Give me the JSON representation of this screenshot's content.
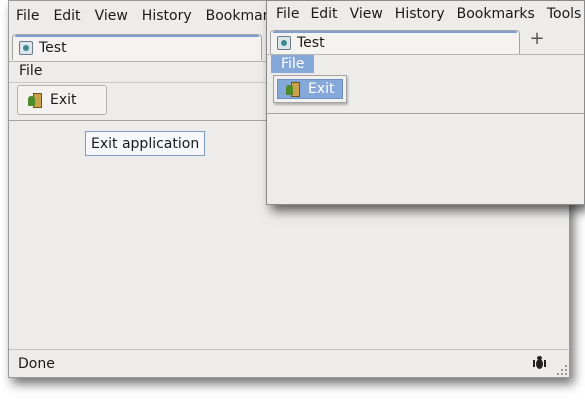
{
  "browser_menu": [
    "File",
    "Edit",
    "View",
    "History",
    "Bookmarks",
    "Tools"
  ],
  "tab_title": "Test",
  "new_tab_symbol": "+",
  "page_menu": {
    "file_label": "File"
  },
  "toolbar": {
    "exit_label": "Exit",
    "exit_icon": "exit-door-icon"
  },
  "tooltip": "Exit application",
  "status": {
    "text": "Done",
    "icon": "bug-icon"
  },
  "dropdown": {
    "exit_label": "Exit"
  },
  "colors": {
    "window_bg": "#edeceb",
    "tab_accent": "#7b9fce",
    "menu_highlight": "#86a8d8",
    "tooltip_border": "#7f9bc3"
  }
}
